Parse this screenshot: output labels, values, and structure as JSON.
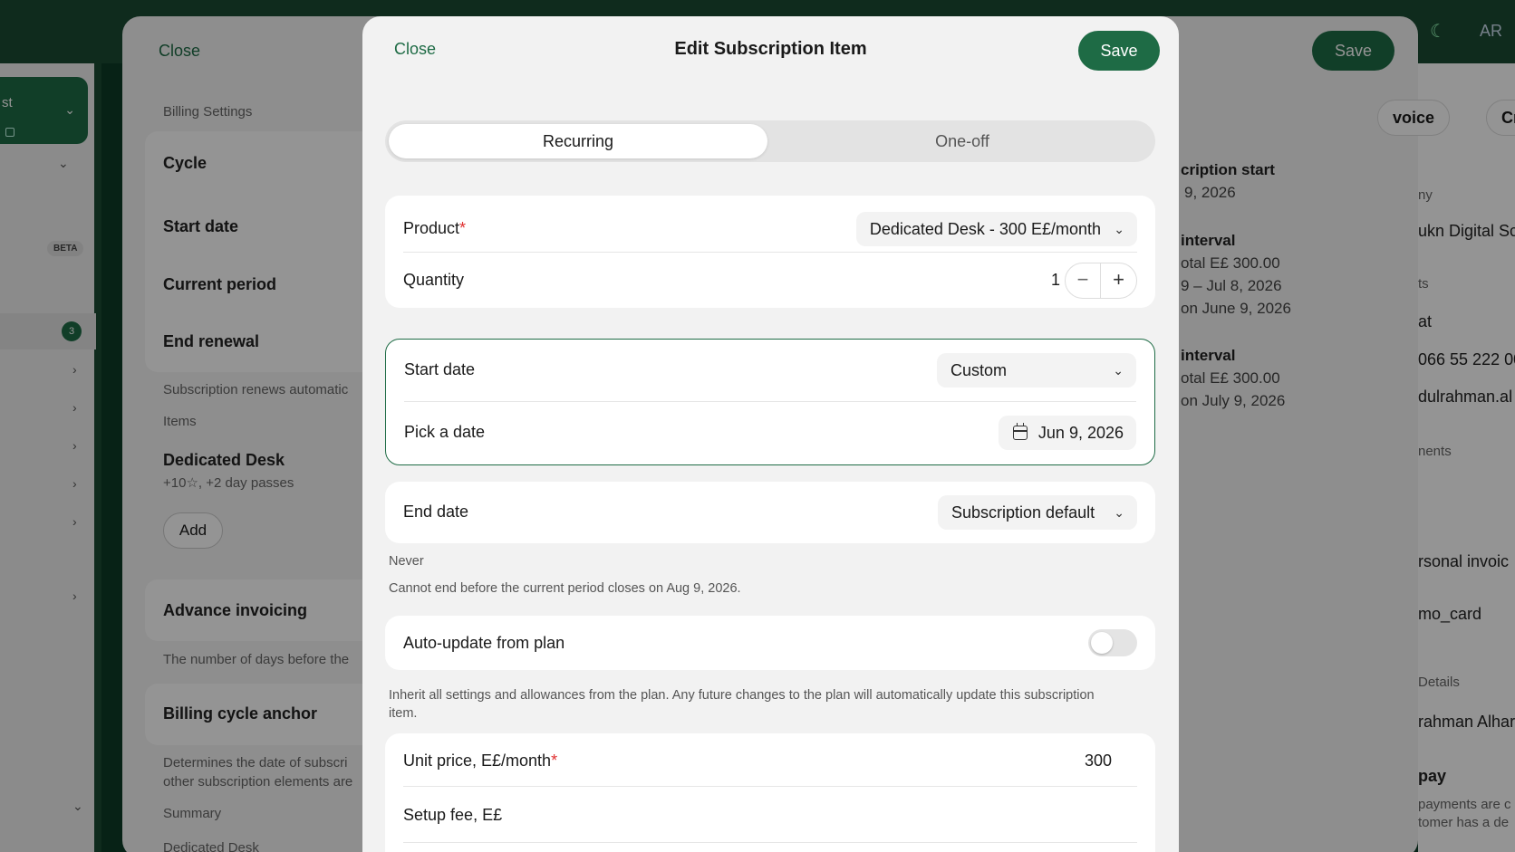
{
  "background": {
    "workspace_name_fragment": "st",
    "beta_badge": "BETA",
    "notification_count": "3",
    "left_panel": {
      "close": "Close",
      "billing_settings": "Billing Settings",
      "cycle": "Cycle",
      "start_date": "Start date",
      "current_period": "Current period",
      "end_renewal": "End renewal",
      "renews_note": "Subscription renews automatic",
      "items": "Items",
      "item_name": "Dedicated Desk",
      "item_sub": "+10☆, +2 day passes",
      "add": "Add",
      "advance_invoicing": "Advance invoicing",
      "advance_note": "The number of days before the",
      "billing_anchor": "Billing cycle anchor",
      "anchor_note_1": "Determines the date of subscri",
      "anchor_note_2": "other subscription elements are",
      "summary": "Summary",
      "summary_item": "Dedicated Desk"
    },
    "right_panel": {
      "subscription_start": "cription start",
      "start_value": "9, 2026",
      "interval_1": "interval",
      "total_1": "otal E£ 300.00",
      "range_1": "9 – Jul 8, 2026",
      "on_1": "on June 9, 2026",
      "interval_2": "interval",
      "total_2": "otal E£ 300.00",
      "on_2": "on July 9, 2026"
    },
    "far_right": {
      "save": "Save",
      "lang": "AR",
      "invoice_pill": "voice",
      "cr_pill": "Cr",
      "company_lbl": "ny",
      "company": "ukn Digital Sc",
      "contacts_lbl": "ts",
      "contact": "at",
      "phone": "066 55 222 00",
      "email": "dulrahman.al",
      "payments_lbl": "nents",
      "personal": "rsonal invoic",
      "promo": "mo_card",
      "details_lbl": "Details",
      "name": "rahman Alhar",
      "pay": "pay",
      "pay_note_1": "payments are c",
      "pay_note_2": "tomer has a de"
    }
  },
  "modal": {
    "close": "Close",
    "title": "Edit Subscription Item",
    "save": "Save",
    "tabs": [
      {
        "label": "Recurring",
        "active": true
      },
      {
        "label": "One-off",
        "active": false
      }
    ],
    "product": {
      "label": "Product",
      "required": "*",
      "value": "Dedicated Desk - 300 E£/month"
    },
    "quantity": {
      "label": "Quantity",
      "value": "1",
      "minus": "−",
      "plus": "+"
    },
    "start_date": {
      "label": "Start date",
      "value": "Custom"
    },
    "pick_date": {
      "label": "Pick a date",
      "value": "Jun 9, 2026"
    },
    "end_date": {
      "label": "End date",
      "value": "Subscription default",
      "note": "Never",
      "constraint": "Cannot end before the current period closes on Aug 9, 2026."
    },
    "auto_update": {
      "label": "Auto-update from plan",
      "enabled": false,
      "help": "Inherit all settings and allowances from the plan. Any future changes to the plan will automatically update this subscription item."
    },
    "unit_price": {
      "label": "Unit price, E£/month",
      "required": "*",
      "value": "300"
    },
    "setup_fee": {
      "label": "Setup fee, E£",
      "value": ""
    }
  },
  "colors": {
    "accent": "#1e6b45",
    "required": "#e03030"
  }
}
